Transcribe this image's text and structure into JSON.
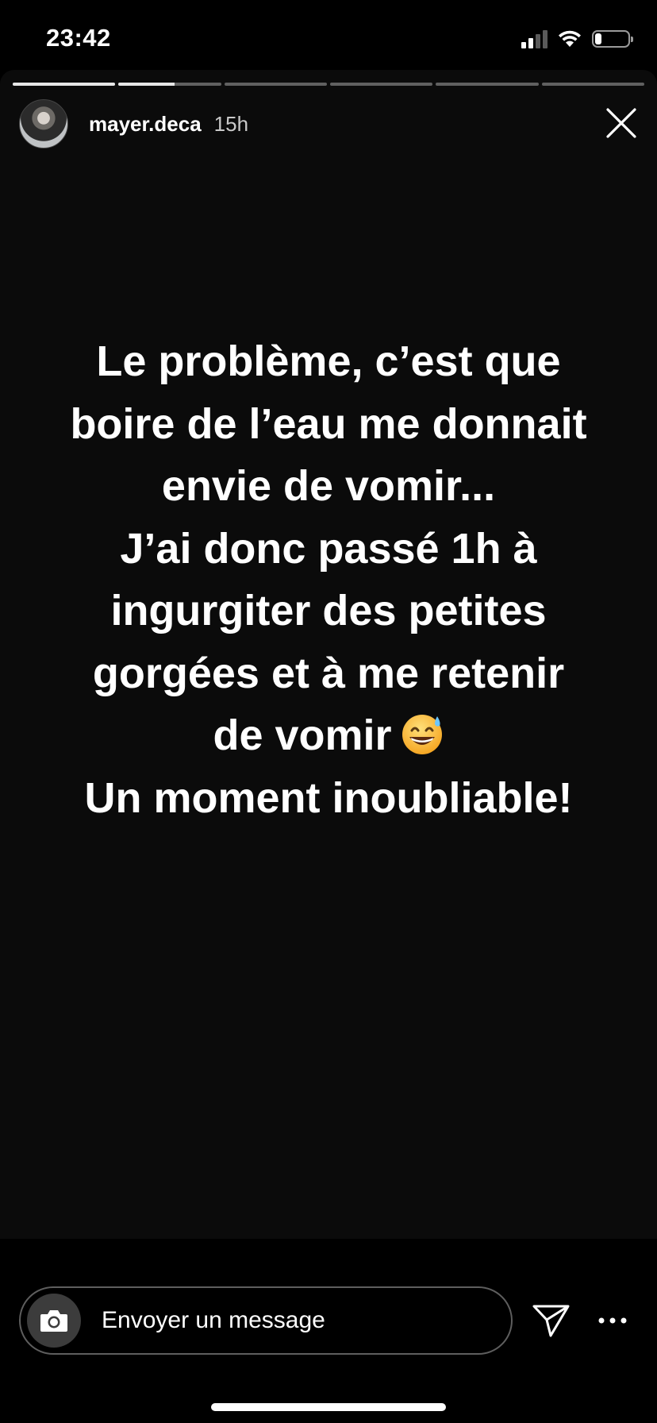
{
  "status_bar": {
    "time": "23:42",
    "icons": [
      "signal-icon",
      "wifi-icon",
      "battery-icon"
    ],
    "battery_level": 0.2
  },
  "story": {
    "segments_total": 6,
    "current_segment": 2,
    "current_segment_progress": 0.55,
    "username": "mayer.deca",
    "time_ago": "15h",
    "text_lines": [
      "Le problème, c’est que",
      "boire de l’eau me donnait",
      "envie de vomir...",
      "J’ai donc passé 1h à",
      "ingurgiter des petites",
      "gorgées et à me retenir",
      "de vomir",
      "Un moment inoubliable!"
    ],
    "emoji": "grinning-face-with-sweat",
    "background_color": "#0b0b0b"
  },
  "bottom_bar": {
    "message_placeholder": "Envoyer un message",
    "icons": [
      "camera-icon",
      "send-icon",
      "more-icon"
    ]
  }
}
